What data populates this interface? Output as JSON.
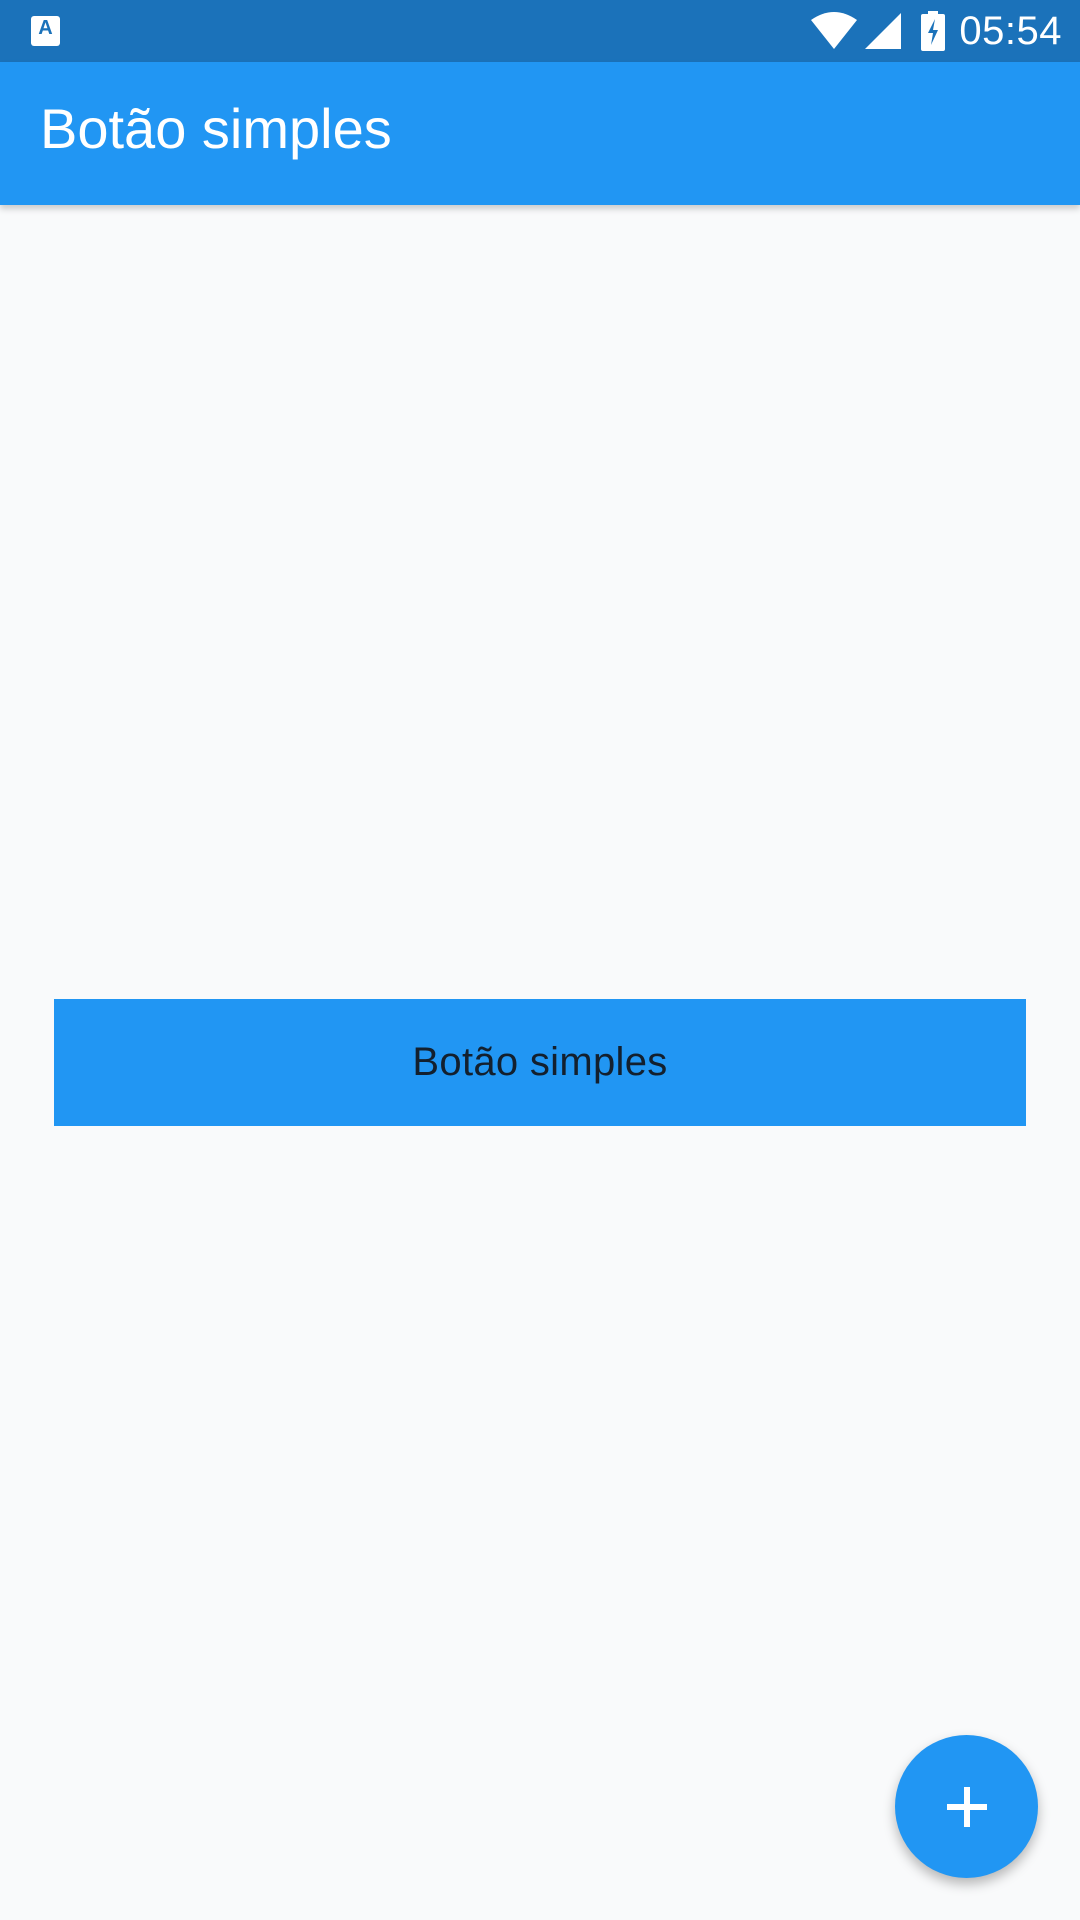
{
  "status_bar": {
    "app_icon": "accessibility-keyboard-icon",
    "app_icon_letter": "A",
    "wifi": "wifi-icon",
    "signal": "signal-icon",
    "battery": "battery-charging-icon",
    "time": "05:54"
  },
  "app_bar": {
    "title": "Botão simples"
  },
  "main": {
    "button_label": "Botão simples"
  },
  "fab": {
    "icon": "add-icon"
  },
  "colors": {
    "status_bar": "#1b72ba",
    "primary": "#2196f3",
    "background": "#f9fafb",
    "button_text": "#13202e",
    "on_primary": "#ffffff"
  }
}
